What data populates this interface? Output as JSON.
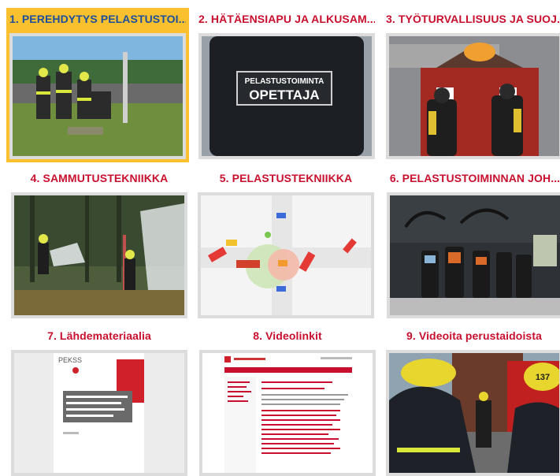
{
  "tiles": [
    {
      "title": "1. PEREHDYTYS PELASTUSTOI..."
    },
    {
      "title": "2. HÄTÄENSIAPU JA ALKUSAM..."
    },
    {
      "title": "3. TYÖTURVALLISUUS JA SUOJ..."
    },
    {
      "title": "4. SAMMUTUSTEKNIIKKA"
    },
    {
      "title": "5. PELASTUSTEKNIIKKA"
    },
    {
      "title": "6. PELASTUSTOIMINNAN JOH..."
    },
    {
      "title": "7. Lähdemateriaalia"
    },
    {
      "title": "8. Videolinkit"
    },
    {
      "title": "9. Videoita perustaidoista"
    }
  ],
  "thumb_text": {
    "vest_line1": "PELASTUSTOIMINTA",
    "vest_line2": "OPETTAJA",
    "doc_header": "PEKSS",
    "doc_title": "PELASTUSYKSIKÖN ENSITOIMENPITEIDEN KUULUVAT SELVITYKSET SAMMUTUSTEHTÄVISSÄ",
    "helmet_number": "137"
  },
  "colors": {
    "accent_red": "#c8102e",
    "active_bg": "#fbc02d",
    "active_title": "#1b4f9c"
  }
}
